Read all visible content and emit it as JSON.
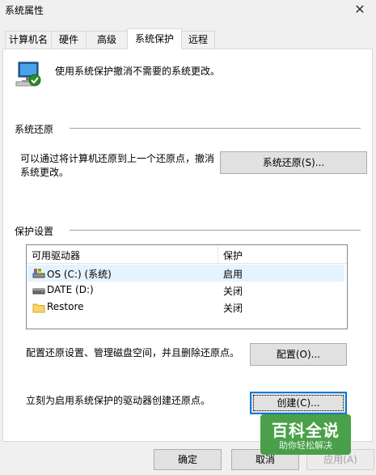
{
  "window": {
    "title": "系统属性",
    "close_glyph": "✕"
  },
  "tabs": [
    {
      "label": "计算机名"
    },
    {
      "label": "硬件"
    },
    {
      "label": "高级"
    },
    {
      "label": "系统保护",
      "active": true
    },
    {
      "label": "远程"
    }
  ],
  "intro": {
    "text": "使用系统保护撤消不需要的系统更改。",
    "icon": "system-protection-icon"
  },
  "restore": {
    "section_title": "系统还原",
    "description_line1": "可以通过将计算机还原到上一个还原点，撤消",
    "description_line2": "系统更改。",
    "button_label": "系统还原(S)..."
  },
  "protection": {
    "section_title": "保护设置",
    "columns": [
      "可用驱动器",
      "保护"
    ],
    "drives": [
      {
        "name": "OS (C:) (系统)",
        "status": "启用",
        "icon": "system-drive-icon",
        "selected": true
      },
      {
        "name": "DATE (D:)",
        "status": "关闭",
        "icon": "drive-icon"
      },
      {
        "name": "Restore",
        "status": "关闭",
        "icon": "folder-icon"
      }
    ],
    "configure_text": "配置还原设置、管理磁盘空间，并且删除还原点。",
    "configure_button": "配置(O)...",
    "create_text": "立刻为启用系统保护的驱动器创建还原点。",
    "create_button": "创建(C)..."
  },
  "footer": {
    "ok": "确定",
    "cancel": "取消",
    "apply": "应用(A)"
  },
  "watermark": {
    "main": "百科全说",
    "sub": "助你轻松解决"
  },
  "colors": {
    "accent": "#0078d7",
    "selection": "#e5f3ff",
    "watermark": "#3c9a3c"
  }
}
